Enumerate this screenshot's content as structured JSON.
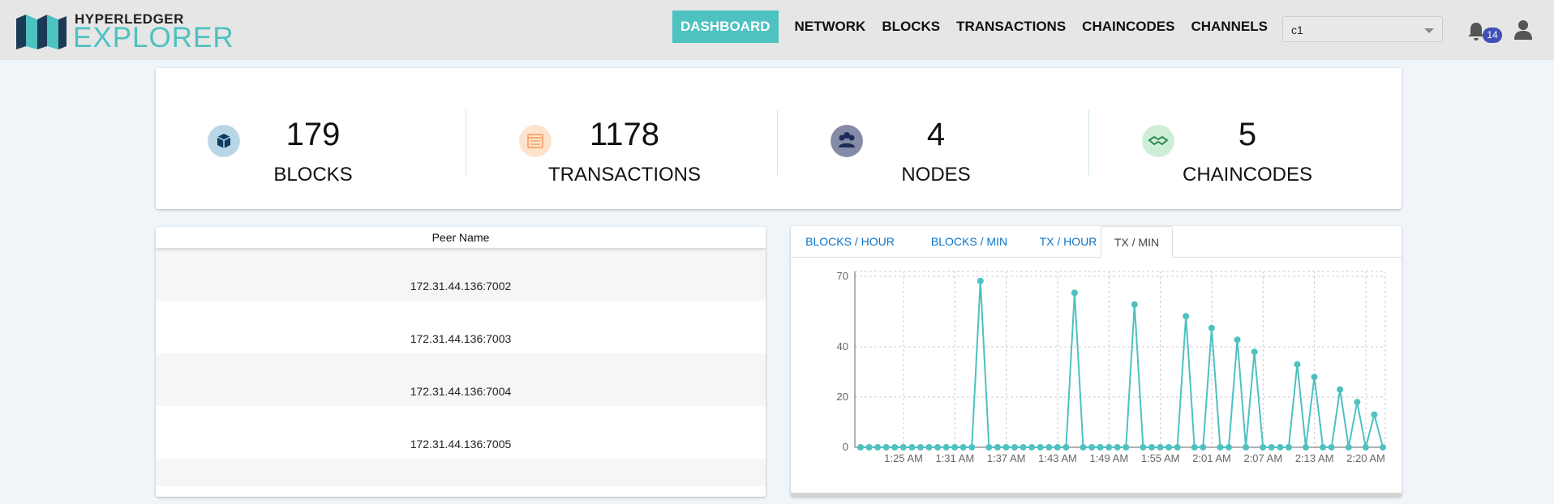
{
  "header": {
    "logo_top": "HYPERLEDGER",
    "logo_bottom": "EXPLORER",
    "nav": [
      "DASHBOARD",
      "NETWORK",
      "BLOCKS",
      "TRANSACTIONS",
      "CHAINCODES",
      "CHANNELS"
    ],
    "active_nav": "DASHBOARD",
    "channel_select": "c1",
    "notification_count": "14",
    "icons": [
      "bell-icon",
      "user-icon"
    ]
  },
  "stats": [
    {
      "value": "179",
      "label": "BLOCKS",
      "icon": "cube-icon",
      "icon_bg": "#b9d6e6",
      "icon_color": "#0d3c61"
    },
    {
      "value": "1178",
      "label": "TRANSACTIONS",
      "icon": "list-icon",
      "icon_bg": "#fde3cc",
      "icon_color": "#f4a36b"
    },
    {
      "value": "4",
      "label": "NODES",
      "icon": "users-icon",
      "icon_bg": "#858ba6",
      "icon_color": "#1f2a5c"
    },
    {
      "value": "5",
      "label": "CHAINCODES",
      "icon": "handshake-icon",
      "icon_bg": "#cfeed7",
      "icon_color": "#2e8b4e"
    }
  ],
  "peers": {
    "header": "Peer Name",
    "rows": [
      "172.31.44.136:7002",
      "172.31.44.136:7003",
      "172.31.44.136:7004",
      "172.31.44.136:7005"
    ]
  },
  "tabs": [
    "BLOCKS / HOUR",
    "BLOCKS / MIN",
    "TX / HOUR",
    "TX / MIN"
  ],
  "active_tab": "TX / MIN",
  "colors": {
    "accent": "#4ec1c1",
    "link": "#0a74c9",
    "badge": "#3f51b5"
  },
  "chart_data": {
    "type": "line",
    "series": [
      {
        "values": [
          0,
          0,
          0,
          0,
          0,
          0,
          0,
          0,
          0,
          0,
          0,
          0,
          0,
          0,
          68,
          0,
          0,
          0,
          0,
          0,
          0,
          0,
          0,
          0,
          0,
          63,
          0,
          0,
          0,
          0,
          0,
          0,
          58,
          0,
          0,
          0,
          0,
          0,
          53,
          0,
          0,
          48,
          0,
          0,
          43,
          0,
          38,
          0,
          0,
          0,
          0,
          33,
          0,
          28,
          0,
          0,
          23,
          0,
          18,
          0,
          13,
          0
        ]
      }
    ],
    "x_ticks": [
      "1:25 AM",
      "1:31 AM",
      "1:37 AM",
      "1:43 AM",
      "1:49 AM",
      "1:55 AM",
      "2:01 AM",
      "2:07 AM",
      "2:13 AM",
      "2:20 AM"
    ],
    "y_ticks": [
      "0",
      "20",
      "40",
      "70"
    ],
    "grid": true,
    "color": "#4ec1c1"
  }
}
